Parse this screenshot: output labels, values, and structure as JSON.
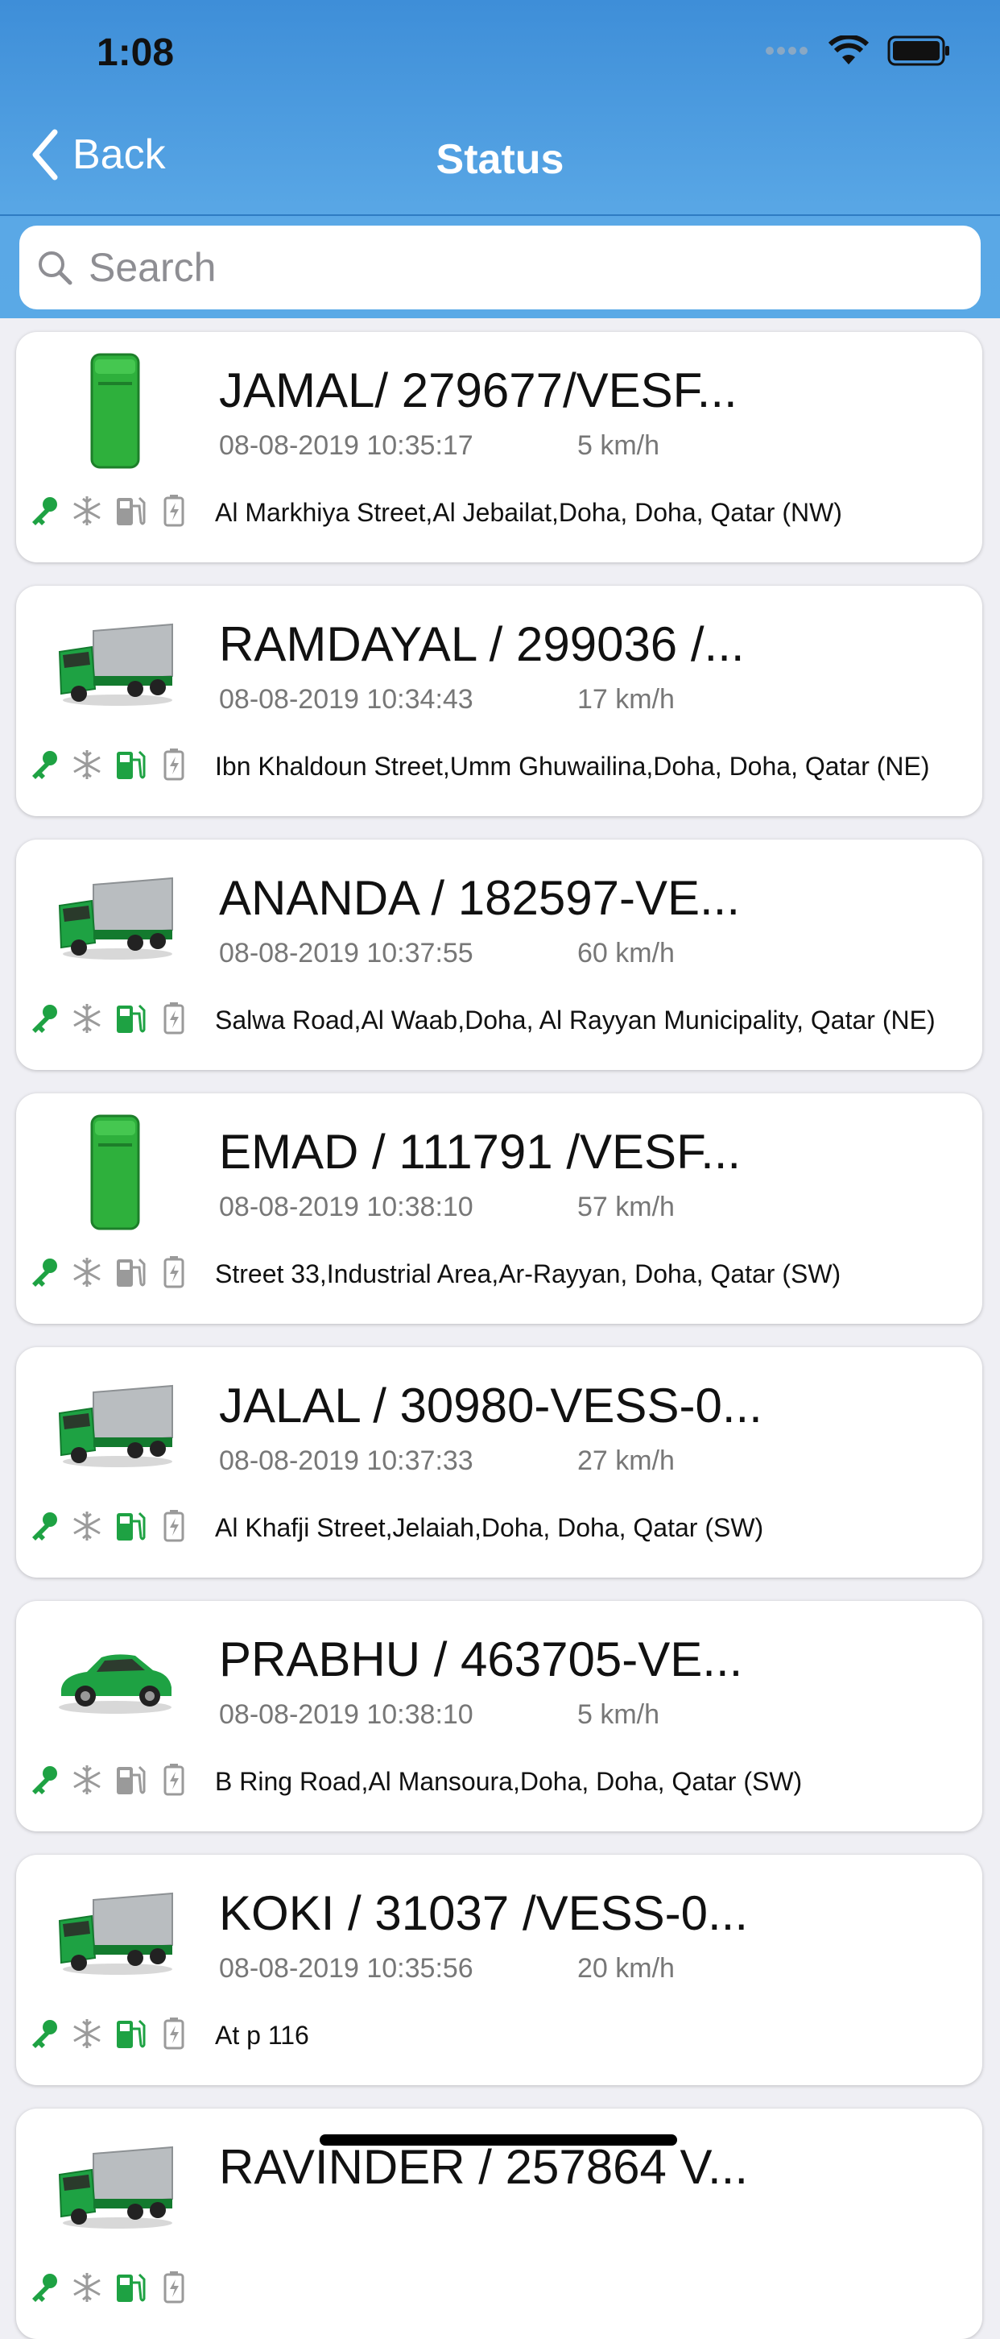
{
  "status_bar": {
    "time": "1:08"
  },
  "nav": {
    "back_label": "Back",
    "title": "Status"
  },
  "search": {
    "placeholder": "Search"
  },
  "colors": {
    "header": "#4c9de2",
    "active_green": "#1ea243",
    "inactive_gray": "#9a9a9a"
  },
  "vehicles": [
    {
      "name": "JAMAL/ 279677/VESF...",
      "datetime": "08-08-2019 10:35:17",
      "speed": "5 km/h",
      "address": "Al Markhiya Street,Al Jebailat,Doha, Doha, Qatar (NW)",
      "icon": "truck-top-icon",
      "fuel_active": false
    },
    {
      "name": "RAMDAYAL / 299036 /...",
      "datetime": "08-08-2019 10:34:43",
      "speed": "17 km/h",
      "address": "Ibn Khaldoun Street,Umm Ghuwailina,Doha, Doha, Qatar (NE)",
      "icon": "truck-icon",
      "fuel_active": true
    },
    {
      "name": "ANANDA / 182597-VE...",
      "datetime": "08-08-2019 10:37:55",
      "speed": "60 km/h",
      "address": "Salwa Road,Al Waab,Doha, Al Rayyan Municipality, Qatar (NE)",
      "icon": "truck-icon",
      "fuel_active": true
    },
    {
      "name": "EMAD / 111791 /VESF...",
      "datetime": "08-08-2019 10:38:10",
      "speed": "57 km/h",
      "address": "Street 33,Industrial Area,Ar-Rayyan, Doha, Qatar (SW)",
      "icon": "truck-top-icon",
      "fuel_active": false
    },
    {
      "name": "JALAL / 30980-VESS-0...",
      "datetime": "08-08-2019 10:37:33",
      "speed": "27 km/h",
      "address": "Al Khafji Street,Jelaiah,Doha, Doha, Qatar (SW)",
      "icon": "truck-icon",
      "fuel_active": true
    },
    {
      "name": "PRABHU / 463705-VE...",
      "datetime": "08-08-2019 10:38:10",
      "speed": "5 km/h",
      "address": "B Ring Road,Al Mansoura,Doha, Doha, Qatar (SW)",
      "icon": "car-icon",
      "fuel_active": false
    },
    {
      "name": "KOKI / 31037 /VESS-0...",
      "datetime": "08-08-2019 10:35:56",
      "speed": "20 km/h",
      "address": "At p 116",
      "icon": "truck-icon",
      "fuel_active": true
    },
    {
      "name": "RAVINDER / 257864 V...",
      "datetime": "",
      "speed": "",
      "address": "",
      "icon": "truck-icon",
      "fuel_active": true
    }
  ]
}
